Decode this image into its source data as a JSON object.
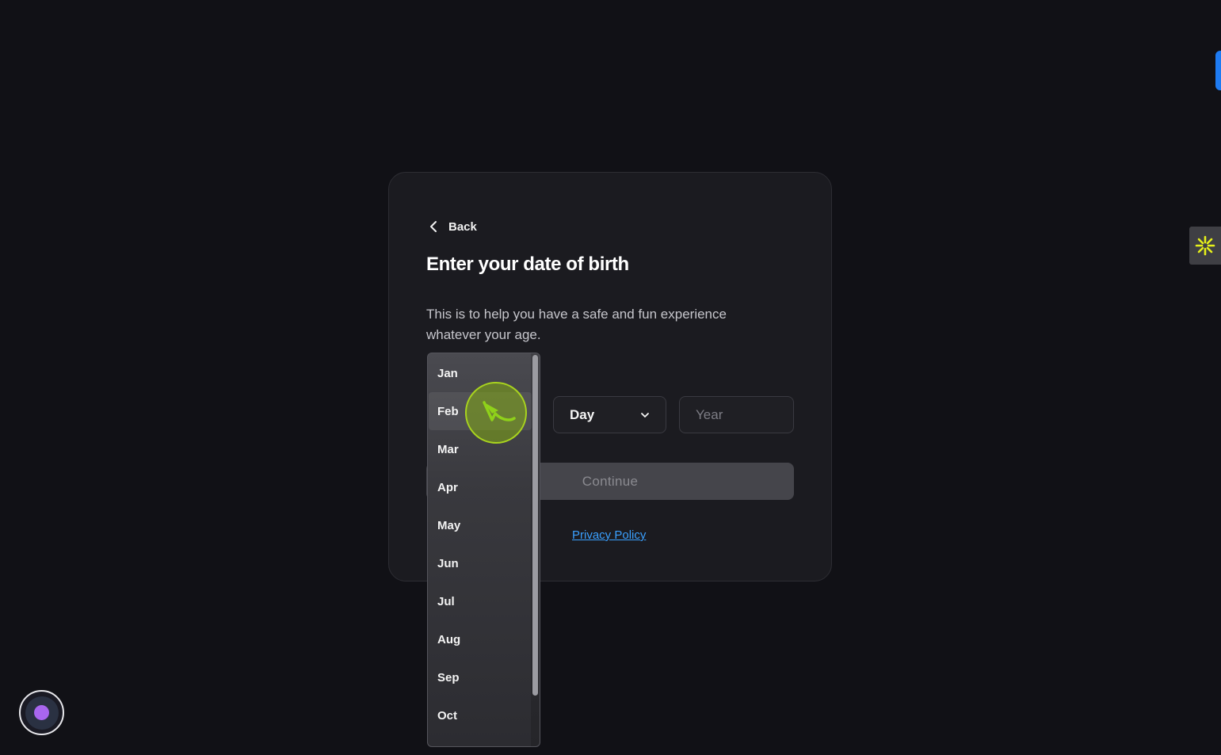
{
  "nav": {
    "back_label": "Back"
  },
  "heading": {
    "title": "Enter your date of birth"
  },
  "description": "This is to help you have a safe and fun experience whatever your age.",
  "form": {
    "day_label": "Day",
    "year_placeholder": "Year",
    "continue_label": "Continue"
  },
  "months": [
    "Jan",
    "Feb",
    "Mar",
    "Apr",
    "May",
    "Jun",
    "Jul",
    "Aug",
    "Sep",
    "Oct"
  ],
  "highlighted_month": "Feb",
  "links": {
    "privacy_label": "Privacy Policy"
  },
  "colors": {
    "background": "#111116",
    "card": "#1b1b20",
    "link": "#3aa0ff",
    "click_indicator": "#a9d41e",
    "right_tab": "#1e7bf2",
    "widget_icon": "#e6f01a",
    "assistant_dot": "#a866ee"
  },
  "icons": {
    "back": "chevron-left-icon",
    "day_dropdown": "chevron-down-icon",
    "side_widget": "sparkle-icon",
    "click_indicator": "curved-arrow-icon"
  }
}
